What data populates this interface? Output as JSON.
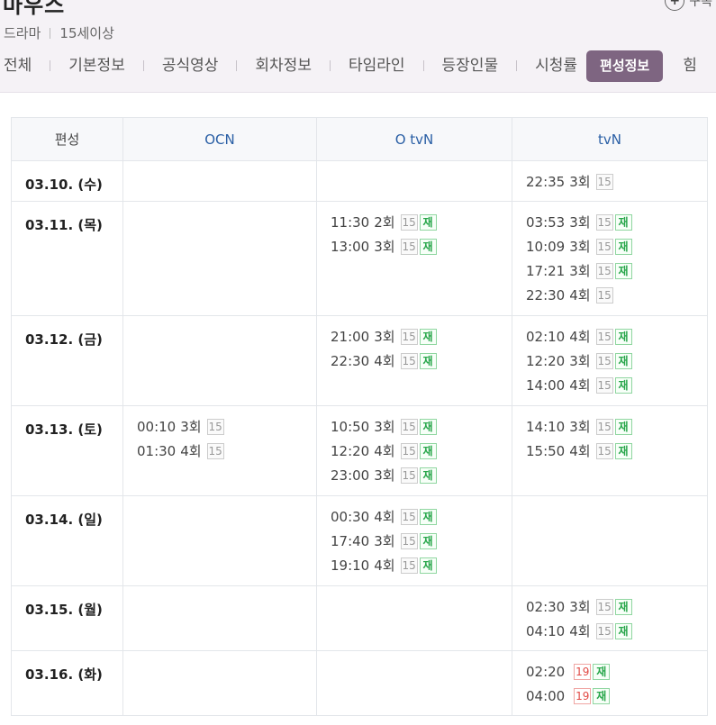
{
  "header": {
    "title": "마우스",
    "subscribe_label": "구독",
    "meta": [
      "드라마",
      "15세이상"
    ]
  },
  "tabs": [
    {
      "label": "전체"
    },
    {
      "label": "기본정보"
    },
    {
      "label": "공식영상"
    },
    {
      "label": "회차정보"
    },
    {
      "label": "타임라인"
    },
    {
      "label": "등장인물"
    },
    {
      "label": "시청률"
    },
    {
      "label": "편성정보",
      "active": true
    },
    {
      "label": "힘"
    }
  ],
  "table": {
    "headers": [
      "편성",
      "OCN",
      "O tvN",
      "tvN"
    ],
    "rows": [
      {
        "day": "03.10. (수)",
        "cells": [
          [],
          [],
          [
            {
              "time": "22:35",
              "ep": "3회",
              "age": "15",
              "re": false
            }
          ]
        ]
      },
      {
        "day": "03.11. (목)",
        "cells": [
          [],
          [
            {
              "time": "11:30",
              "ep": "2회",
              "age": "15",
              "re": true
            },
            {
              "time": "13:00",
              "ep": "3회",
              "age": "15",
              "re": true
            }
          ],
          [
            {
              "time": "03:53",
              "ep": "3회",
              "age": "15",
              "re": true
            },
            {
              "time": "10:09",
              "ep": "3회",
              "age": "15",
              "re": true
            },
            {
              "time": "17:21",
              "ep": "3회",
              "age": "15",
              "re": true
            },
            {
              "time": "22:30",
              "ep": "4회",
              "age": "15",
              "re": false
            }
          ]
        ]
      },
      {
        "day": "03.12. (금)",
        "cells": [
          [],
          [
            {
              "time": "21:00",
              "ep": "3회",
              "age": "15",
              "re": true
            },
            {
              "time": "22:30",
              "ep": "4회",
              "age": "15",
              "re": true
            }
          ],
          [
            {
              "time": "02:10",
              "ep": "4회",
              "age": "15",
              "re": true
            },
            {
              "time": "12:20",
              "ep": "3회",
              "age": "15",
              "re": true
            },
            {
              "time": "14:00",
              "ep": "4회",
              "age": "15",
              "re": true
            }
          ]
        ]
      },
      {
        "day": "03.13. (토)",
        "cells": [
          [
            {
              "time": "00:10",
              "ep": "3회",
              "age": "15",
              "re": false
            },
            {
              "time": "01:30",
              "ep": "4회",
              "age": "15",
              "re": false
            }
          ],
          [
            {
              "time": "10:50",
              "ep": "3회",
              "age": "15",
              "re": true
            },
            {
              "time": "12:20",
              "ep": "4회",
              "age": "15",
              "re": true
            },
            {
              "time": "23:00",
              "ep": "3회",
              "age": "15",
              "re": true
            }
          ],
          [
            {
              "time": "14:10",
              "ep": "3회",
              "age": "15",
              "re": true
            },
            {
              "time": "15:50",
              "ep": "4회",
              "age": "15",
              "re": true
            }
          ]
        ]
      },
      {
        "day": "03.14. (일)",
        "cells": [
          [],
          [
            {
              "time": "00:30",
              "ep": "4회",
              "age": "15",
              "re": true
            },
            {
              "time": "17:40",
              "ep": "3회",
              "age": "15",
              "re": true
            },
            {
              "time": "19:10",
              "ep": "4회",
              "age": "15",
              "re": true
            }
          ],
          []
        ]
      },
      {
        "day": "03.15. (월)",
        "cells": [
          [],
          [],
          [
            {
              "time": "02:30",
              "ep": "3회",
              "age": "15",
              "re": true
            },
            {
              "time": "04:10",
              "ep": "4회",
              "age": "15",
              "re": true
            }
          ]
        ]
      },
      {
        "day": "03.16. (화)",
        "cells": [
          [],
          [],
          [
            {
              "time": "02:20",
              "ep": "",
              "age": "19",
              "re": true
            },
            {
              "time": "04:00",
              "ep": "",
              "age": "19",
              "re": true
            }
          ]
        ]
      }
    ],
    "rerun_label": "재"
  },
  "colors": {
    "active_tab_bg": "#7e6581",
    "channel_header": "#2a5fa5",
    "rerun_green": "#27a64a",
    "age19_red": "#e14a45"
  }
}
